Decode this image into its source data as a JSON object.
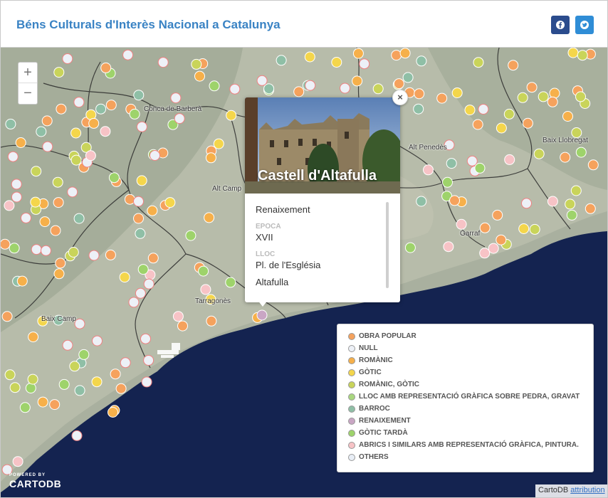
{
  "header": {
    "title": "Béns Culturals d'Interès Nacional a Catalunya",
    "facebook_icon": "facebook-icon",
    "twitter_icon": "twitter-icon",
    "facebook_color": "#2b4c8d",
    "twitter_color": "#2f8dd6"
  },
  "zoom": {
    "in_label": "+",
    "out_label": "−"
  },
  "places": [
    "Conca de Barberà",
    "Alt Penedès",
    "Baix Llobregat",
    "Alt Camp",
    "Garraf",
    "Tarragonès",
    "Baix Camp"
  ],
  "popup": {
    "title": "Castell d'Altafulla",
    "close_label": "×",
    "style_value": "Renaixement",
    "epoca_label": "EPOCA",
    "epoca_value": "XVII",
    "lloc_label": "LLOC",
    "lloc_value": "Pl. de l'Església",
    "municipi_value": "Altafulla"
  },
  "legend": [
    {
      "label": "OBRA POPULAR",
      "color": "#f5a25d"
    },
    {
      "label": "NULL",
      "color": "#edf1f7"
    },
    {
      "label": "ROMÀNIC",
      "color": "#f6b04a"
    },
    {
      "label": "GÒTIC",
      "color": "#f4d64b"
    },
    {
      "label": "ROMÀNIC, GÒTIC",
      "color": "#c9d45a"
    },
    {
      "label": "LLOC AMB REPRESENTACIÓ GRÀFICA SOBRE PEDRA, GRAVAT",
      "color": "#a9d77f"
    },
    {
      "label": "BARROC",
      "color": "#8fbfa6"
    },
    {
      "label": "RENAIXEMENT",
      "color": "#c9a6c4"
    },
    {
      "label": "GÒTIC TARDÀ",
      "color": "#9ed36b"
    },
    {
      "label": "ABRICS I SIMILARS AMB REPRESENTACIÓ GRÀFICA, PINTURA.",
      "color": "#f7c3c6"
    },
    {
      "label": "OTHERS",
      "color": "#e8eef6"
    }
  ],
  "footer": {
    "powered_by": "POWERED BY",
    "brand": "CARTODB",
    "attribution_prefix": "CartoDB",
    "attribution_link": "attribution"
  },
  "colors": {
    "sea": "#142350",
    "land": "#a6ad9c"
  }
}
